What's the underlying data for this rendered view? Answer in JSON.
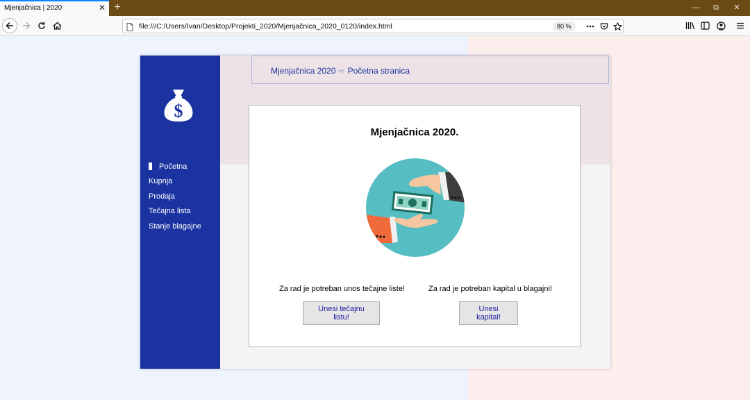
{
  "browser": {
    "tab_title": "Mjenjačnica | 2020",
    "url": "file:///C:/Users/Ivan/Desktop/Projekti_2020/Mjenjačnica_2020_0120/index.html",
    "zoom": "80 %"
  },
  "breadcrumb": {
    "root": "Mjenjačnica 2020",
    "separator": "⇨",
    "current": "Početna stranica"
  },
  "sidebar": {
    "items": [
      {
        "label": "Početna"
      },
      {
        "label": "Kupnja"
      },
      {
        "label": "Prodaja"
      },
      {
        "label": "Tečajna lista"
      },
      {
        "label": "Stanje blagajne"
      }
    ]
  },
  "main": {
    "title": "Mjenjačnica 2020.",
    "hint_left": "Za rad je potreban unos tečajne liste!",
    "hint_right": "Za rad je potreban kapital u blagajni!",
    "button_exchange": "Unesi tečajnu listu!",
    "button_capital": "Unesi kapital!"
  },
  "colors": {
    "sidebar": "#1a33a0",
    "accent_text": "#1a33a0",
    "illustration_circle": "#56bdc2"
  }
}
